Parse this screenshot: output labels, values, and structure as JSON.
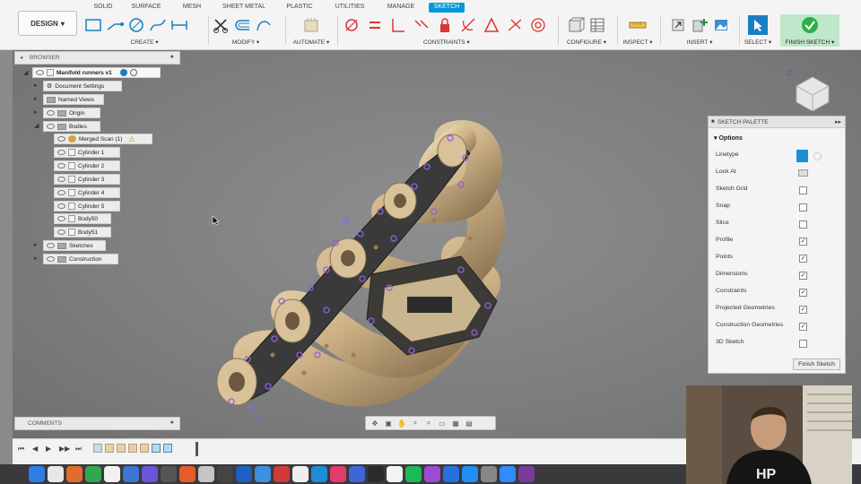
{
  "toolbar": {
    "workspace": "DESIGN",
    "tabs": [
      "SOLID",
      "SURFACE",
      "MESH",
      "SHEET METAL",
      "PLASTIC",
      "UTILITIES",
      "MANAGE",
      "SKETCH"
    ],
    "active_tab": "SKETCH",
    "groups": {
      "create": "CREATE",
      "modify": "MODIFY",
      "automate": "AUTOMATE",
      "constraints": "CONSTRAINTS",
      "configure": "CONFIGURE",
      "inspect": "INSPECT",
      "insert": "INSERT",
      "select": "SELECT",
      "finish_sketch": "FINISH SKETCH"
    }
  },
  "browser": {
    "title": "BROWSER",
    "root": "Manifold runners v1",
    "items": [
      {
        "label": "Document Settings"
      },
      {
        "label": "Named Views"
      },
      {
        "label": "Origin"
      },
      {
        "label": "Bodies"
      },
      {
        "label": "Merged Scan (1)"
      },
      {
        "label": "Cylinder 1"
      },
      {
        "label": "Cylinder 2"
      },
      {
        "label": "Cylinder 3"
      },
      {
        "label": "Cylinder 4"
      },
      {
        "label": "Cylinder 5"
      },
      {
        "label": "Body50"
      },
      {
        "label": "Body51"
      },
      {
        "label": "Sketches"
      },
      {
        "label": "Construction"
      }
    ]
  },
  "palette": {
    "title": "SKETCH PALETTE",
    "section": "Options",
    "rows": [
      {
        "label": "Linetype",
        "checked": null
      },
      {
        "label": "Look At",
        "checked": null
      },
      {
        "label": "Sketch Grid",
        "checked": false
      },
      {
        "label": "Snap",
        "checked": false
      },
      {
        "label": "Slice",
        "checked": false
      },
      {
        "label": "Profile",
        "checked": true
      },
      {
        "label": "Points",
        "checked": true
      },
      {
        "label": "Dimensions",
        "checked": true
      },
      {
        "label": "Constraints",
        "checked": true
      },
      {
        "label": "Projected Geometries",
        "checked": true
      },
      {
        "label": "Construction Geometries",
        "checked": true
      },
      {
        "label": "3D Sketch",
        "checked": false
      }
    ],
    "finish_button": "Finish Sketch"
  },
  "comments": {
    "title": "COMMENTS"
  },
  "colors": {
    "accent": "#0696d7",
    "finish_green": "#2bb14a",
    "model": "#d6c09a"
  }
}
